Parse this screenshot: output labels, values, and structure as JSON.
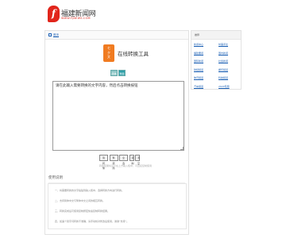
{
  "site": {
    "logo_glyph": "f",
    "logo_name": "福建新闻网",
    "logo_url": "WWW.FJNEWS.COM",
    "brand_color": "#e1251b"
  },
  "breadcrumb": {
    "home_label": "首页"
  },
  "tool": {
    "badge_lines": [
      "七",
      "夕",
      "文"
    ],
    "badge_color": "#f07b21",
    "title": "在线转换工具",
    "tabs": [
      "简体",
      "繁體"
    ],
    "accent": "#2f9fa8",
    "editor_text": "请在此输入需要转换的文字内容，然后点击转换按钮",
    "buttons": [
      "简转繁",
      "繁转简",
      "全选",
      "复制",
      "清空"
    ],
    "hint": "转换结果将显示在上方输入框中，可直接复制使用"
  },
  "notes": {
    "title": "使用说明",
    "items": [
      "一、将需要转换的文字粘贴到输入框中，选择转换方向进行转换。",
      "二、支持简体中文与繁体中文之间的相互转换。",
      "三、转换完成后可使用复制按钮快速复制转换结果。",
      "四、如遇个别字词转换不准确，请手动校对修改后使用，谢谢“支持”。"
    ]
  },
  "sidebar": {
    "title": "推荐",
    "links": [
      "新闻中心",
      "时事评论",
      "福建要闻",
      "国内新闻",
      "国际新闻",
      "社会新闻",
      "财经频道",
      "娱乐频道",
      "体育频道",
      "科技频道",
      "汽车频道",
      "2020专题"
    ]
  }
}
